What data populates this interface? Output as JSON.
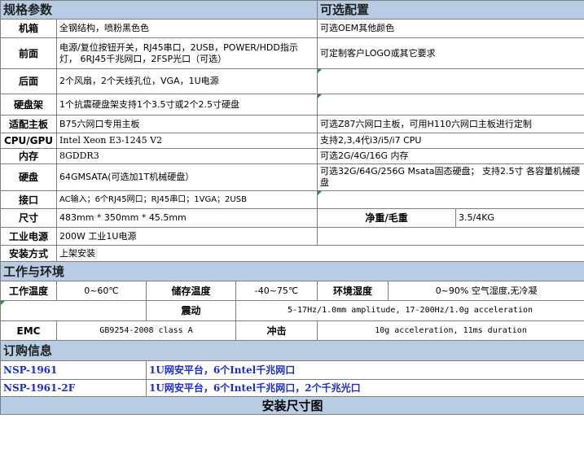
{
  "spec_header": {
    "left": "规格参数",
    "right": "可选配置"
  },
  "specs": [
    {
      "label": "机箱",
      "value": "全钢结构，喷粉黑色色",
      "option": "可选OEM其他颜色"
    },
    {
      "label": "前面",
      "value": "电源/复位按钮开关，RJ45串口，2USB，POWER/HDD指示灯， 6RJ45千兆网口，2FSP光口（可选）",
      "option": "可定制客户LOGO或其它要求"
    },
    {
      "label": "后面",
      "value": "2个风扇，2个天线孔位，VGA，1U电源",
      "option": ""
    },
    {
      "label": "硬盘架",
      "value": "1个抗震硬盘架支持1个3.5寸或2个2.5寸硬盘",
      "option": ""
    },
    {
      "label": "适配主板",
      "value": "B75六网口专用主板",
      "option": "可选Z87六网口主板，可用H110六网口主板进行定制"
    },
    {
      "label": "CPU/GPU",
      "value": "Intel Xeon E3-1245 V2",
      "option": "支持2,3,4代i3/i5/i7 CPU"
    },
    {
      "label": "内存",
      "value": "8GDDR3",
      "option": "可选2G/4G/16G 内存"
    },
    {
      "label": "硬盘",
      "value": "64GMSATA(可选加1T机械硬盘）",
      "option": "可选32G/64G/256G Msata固态硬盘； 支持2.5寸 各容量机械硬盘"
    },
    {
      "label": "接口",
      "value": "AC输入；6个RJ45网口；RJ45串口；1VGA；2USB",
      "option": ""
    },
    {
      "label": "尺寸",
      "value": "483mm  * 350mm * 45.5mm",
      "weight_label": "净重/毛重",
      "weight_value": "3.5/4KG"
    },
    {
      "label": "工业电源",
      "value": "200W 工业1U电源",
      "option": ""
    },
    {
      "label": "安装方式",
      "value": "上架安装"
    }
  ],
  "env_header": "工作与环境",
  "env": {
    "work_temp_label": "工作温度",
    "work_temp_value": "0~60℃",
    "store_temp_label": "储存温度",
    "store_temp_value": "-40~75℃",
    "humidity_label": "环境湿度",
    "humidity_value": "0~90% 空气湿度,无冷凝",
    "vibration_label": "震动",
    "vibration_value": "5-17Hz/1.0mm amplitude, 17-200Hz/1.0g acceleration",
    "emc_label": "EMC",
    "emc_value": "GB9254-2008 class A",
    "shock_label": "冲击",
    "shock_value": "10g acceleration, 11ms duration"
  },
  "order_header": "订购信息",
  "orders": [
    {
      "model": "NSP-1961",
      "desc": "1U网安平台，6个Intel千兆网口"
    },
    {
      "model": "NSP-1961-2F",
      "desc": "1U网安平台，6个Intel千兆网口，2个千兆光口"
    }
  ],
  "install_header": "安装尺寸图"
}
